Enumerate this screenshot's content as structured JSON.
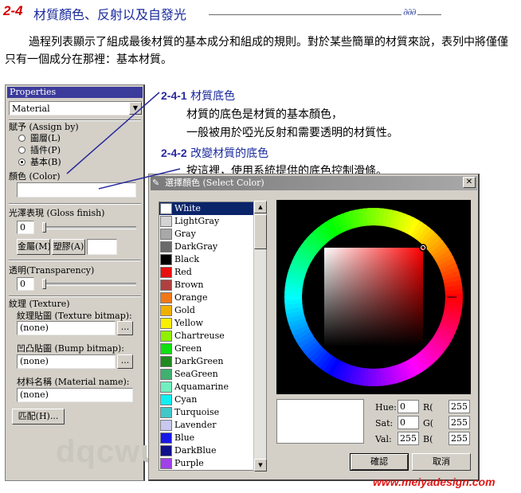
{
  "header": {
    "section_number": "2-4",
    "title": "材質顏色、反射以及自發光",
    "ornament": "∂∂∂"
  },
  "intro_text": "過程列表顯示了組成最後材質的基本成分和組成的規則。對於某些簡單的材質來說，表列中將僅僅只有一個成分在那裡：基本材質。",
  "properties": {
    "title": "Properties",
    "material_dropdown": "Material",
    "assign_label": "賦予 (Assign by)",
    "radio_layer": "圖層(L)",
    "radio_plugin": "插件(P)",
    "radio_base": "基本(B)",
    "selected_radio": "基本(B)",
    "color_label": "顏色 (Color)",
    "color_value": "",
    "gloss_label": "光澤表現 (Gloss finish)",
    "gloss_value": "0",
    "gloss_level": 0,
    "metal_button": "金屬(M)",
    "plastic_button": "塑膠(A)",
    "transparency_label": "透明(Transparency)",
    "transparency_value": "0",
    "transparency_level": 0,
    "texture_label": "紋理 (Texture)",
    "texture_bitmap_label": "紋理貼圖 (Texture bitmap):",
    "texture_bitmap_value": "(none)",
    "bump_bitmap_label": "凹凸貼圖 (Bump bitmap):",
    "bump_bitmap_value": "(none)",
    "browse_label": "...",
    "material_name_label": "材料名稱 (Material name):",
    "material_name_value": "(none)",
    "match_button": "匹配(H)...",
    "watermark": "dqcwu"
  },
  "annotations": [
    {
      "number": "2-4-1",
      "title": "材質底色",
      "lines": [
        "材質的底色是材質的基本顏色，",
        "一般被用於啞光反射和需要透明的材質性。"
      ]
    },
    {
      "number": "2-4-2",
      "title": "改變材質的底色",
      "lines": [
        "按這裡，使用系統提供的底色控制滑條。"
      ]
    }
  ],
  "dialog": {
    "title": "選擇顏色 (Select Color)",
    "close_glyph": "✕",
    "colors": [
      {
        "name": "White",
        "hex": "#ffffff"
      },
      {
        "name": "LightGray",
        "hex": "#d4d4d4"
      },
      {
        "name": "Gray",
        "hex": "#a8a8a8"
      },
      {
        "name": "DarkGray",
        "hex": "#6a6a6a"
      },
      {
        "name": "Black",
        "hex": "#000000"
      },
      {
        "name": "Red",
        "hex": "#e81010"
      },
      {
        "name": "Brown",
        "hex": "#b04040"
      },
      {
        "name": "Orange",
        "hex": "#f07818"
      },
      {
        "name": "Gold",
        "hex": "#f0b000"
      },
      {
        "name": "Yellow",
        "hex": "#f8f000"
      },
      {
        "name": "Chartreuse",
        "hex": "#90f000"
      },
      {
        "name": "Green",
        "hex": "#10e010"
      },
      {
        "name": "DarkGreen",
        "hex": "#208a20"
      },
      {
        "name": "SeaGreen",
        "hex": "#40b070"
      },
      {
        "name": "Aquamarine",
        "hex": "#70f0c0"
      },
      {
        "name": "Cyan",
        "hex": "#10f0f0"
      },
      {
        "name": "Turquoise",
        "hex": "#40c8c8"
      },
      {
        "name": "Lavender",
        "hex": "#c8c8f0"
      },
      {
        "name": "Blue",
        "hex": "#1818e8"
      },
      {
        "name": "DarkBlue",
        "hex": "#10108a"
      },
      {
        "name": "Purple",
        "hex": "#a040e8"
      }
    ],
    "selected_color": "White",
    "hue_label": "Hue:",
    "hue_value": "0",
    "sat_label": "Sat:",
    "sat_value": "0",
    "val_label": "Val:",
    "val_value": "255",
    "r_label": "R(",
    "r_value": "255",
    "g_label": "G(",
    "g_value": "255",
    "b_label": "B(",
    "b_value": "255",
    "ok_button": "確認",
    "cancel_button": "取消"
  },
  "footer_url": "www.meiyadesign.com",
  "colors": {
    "accent_red": "#d40000",
    "title_blue": "#1a2a9c",
    "selection_blue": "#0a246a",
    "panel_gray": "#d4d0c8"
  }
}
